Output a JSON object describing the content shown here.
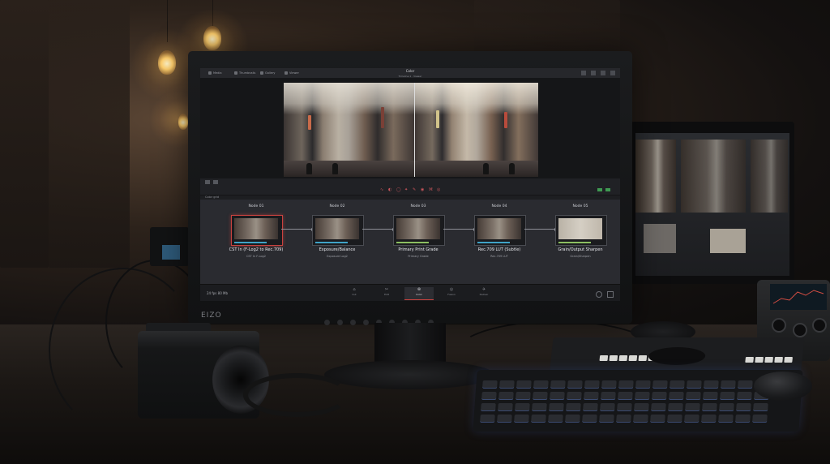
{
  "app": {
    "page_title": "Color",
    "clip_title": "Timeline 1 · Viewer",
    "topbar_tabs": [
      "Media",
      "Thumbnails",
      "Gallery",
      "Viewer"
    ],
    "nodes_label": "Color grid",
    "status_text": "24 fps   80 Mb",
    "page_tabs": [
      {
        "label": "Cut",
        "glyph": "⌂"
      },
      {
        "label": "Edit",
        "glyph": "✂"
      },
      {
        "label": "Color",
        "glyph": "⊛"
      },
      {
        "label": "Fusion",
        "glyph": "◎"
      },
      {
        "label": "Deliver",
        "glyph": "✈"
      }
    ],
    "active_page": "Color"
  },
  "nodes": [
    {
      "title": "Node 01",
      "label": "CST In (F-Log2 to Rec.709)",
      "sublabel": "CST In F-Log2",
      "selected": true,
      "bar_color": "#3fa3c7"
    },
    {
      "title": "Node 02",
      "label": "Exposure/Balance",
      "sublabel": "Exposure Log2",
      "selected": false,
      "bar_color": "#3fa3c7"
    },
    {
      "title": "Node 03",
      "label": "Primary Print Grade",
      "sublabel": "Primary Grade",
      "selected": false,
      "bar_color": "#8cbf61"
    },
    {
      "title": "Node 04",
      "label": "Rec.709 LUT (Subtle)",
      "sublabel": "Rec.709 LUT",
      "selected": false,
      "bar_color": "#3fa3c7"
    },
    {
      "title": "Node 05",
      "label": "Grain/Output Sharpen",
      "sublabel": "Grain/Sharpen",
      "selected": false,
      "bar_color": "#8cbf61"
    }
  ],
  "hardware": {
    "monitor_brand": "EIZO"
  },
  "colors": {
    "accent": "#c9423f",
    "node_bar_blue": "#3fa3c7",
    "node_bar_green": "#8cbf61",
    "lamp": "#ffcf6d"
  }
}
